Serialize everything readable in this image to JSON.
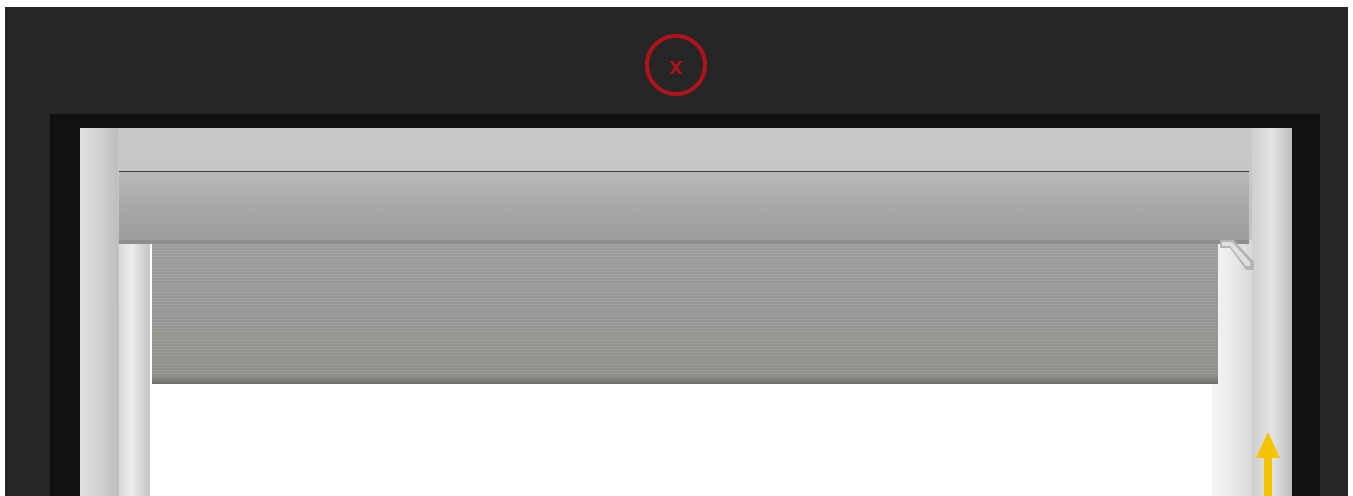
{
  "scene": {
    "description_label": "",
    "colors": {
      "wall": "#262626",
      "recess": "#c4c4c4",
      "cassette": "#a6a6a6",
      "fabric": "#9e9c99",
      "close_ring": "#b3121b",
      "arrow": "#f5c400"
    }
  },
  "close_button": {
    "glyph": "x",
    "icon": "close-icon"
  },
  "arrow": {
    "icon": "up-arrow-icon",
    "direction": "up"
  }
}
